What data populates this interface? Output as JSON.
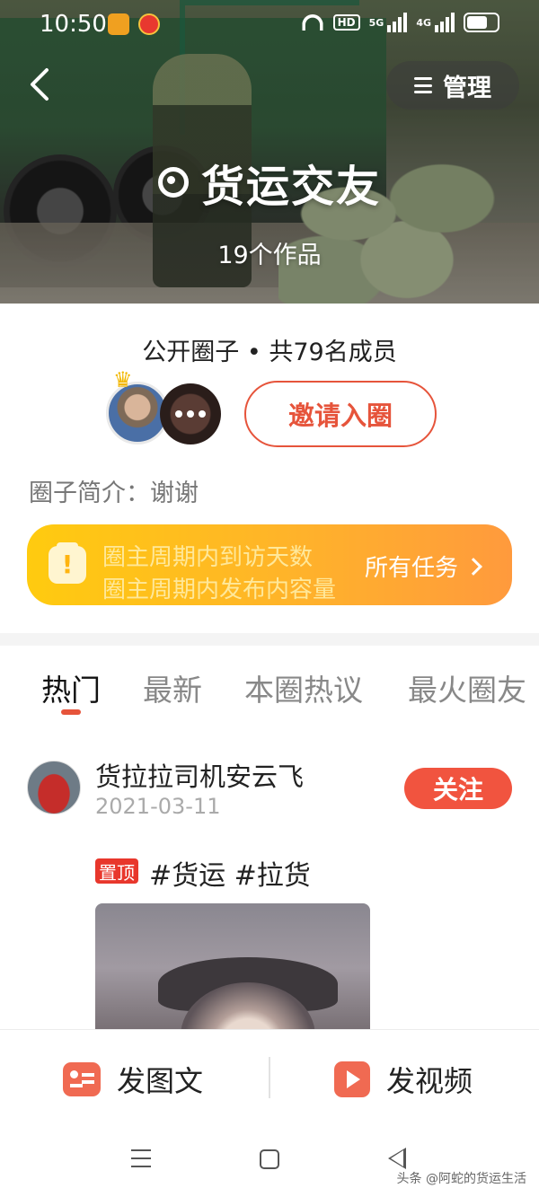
{
  "status_bar": {
    "time": "10:50",
    "hd": "HD",
    "net1": "5G",
    "net2": "4G"
  },
  "header": {
    "manage_label": "管理",
    "circle_name": "货运交友",
    "works_count": "19个作品"
  },
  "circle_info": {
    "public_info": "公开圈子 • 共79名成员",
    "invite_label": "邀请入圈",
    "intro": "圈子简介：谢谢"
  },
  "task_banner": {
    "line1": "圈主周期内到访天数",
    "line2": "圈主周期内发布内容量",
    "all_tasks": "所有任务"
  },
  "tabs": [
    {
      "label": "热门"
    },
    {
      "label": "最新"
    },
    {
      "label": "本圈热议"
    },
    {
      "label": "最火圈友"
    }
  ],
  "post": {
    "author": "货拉拉司机安云飞",
    "date": "2021-03-11",
    "follow_label": "关注",
    "pinned_label": "置顶",
    "tags": "#货运 #拉货"
  },
  "publish_bar": {
    "image_text_label": "发图文",
    "video_label": "发视频"
  },
  "watermark": "头条 @阿蛇的货运生活",
  "colors": {
    "accent": "#e6543b",
    "follow": "#f1543f",
    "banner_start": "#ffcb0f",
    "banner_end": "#ff9a3d"
  }
}
